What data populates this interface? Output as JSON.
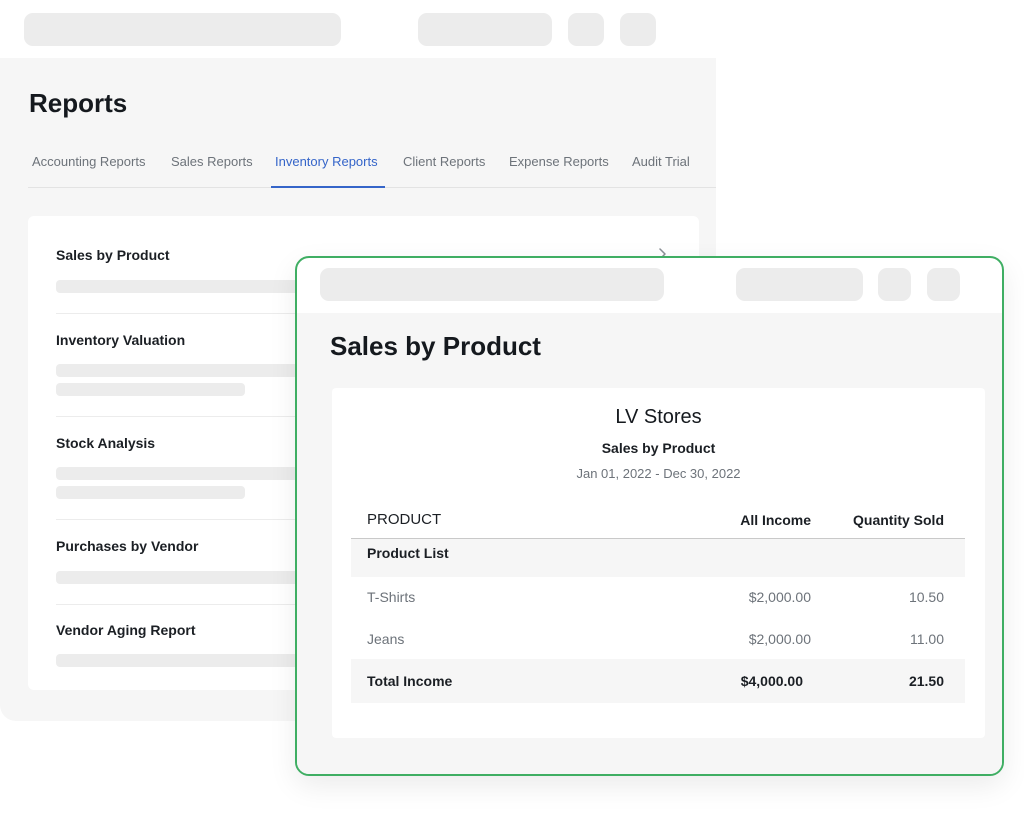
{
  "reports": {
    "title": "Reports",
    "tabs": [
      {
        "label": "Accounting Reports"
      },
      {
        "label": "Sales Reports"
      },
      {
        "label": "Inventory Reports",
        "active": true
      },
      {
        "label": "Client Reports"
      },
      {
        "label": "Expense Reports"
      },
      {
        "label": "Audit Trial"
      }
    ],
    "items": [
      {
        "label": "Sales by Product"
      },
      {
        "label": "Inventory Valuation"
      },
      {
        "label": "Stock Analysis"
      },
      {
        "label": "Purchases by Vendor"
      },
      {
        "label": "Vendor Aging Report"
      }
    ]
  },
  "sales_report": {
    "window_title": "Sales by Product",
    "company": "LV Stores",
    "report_name": "Sales by Product",
    "period": "Jan 01, 2022 - Dec 30, 2022",
    "columns": {
      "product": "PRODUCT",
      "income": "All Income",
      "quantity": "Quantity Sold"
    },
    "group_label": "Product List",
    "rows": [
      {
        "product": "T-Shirts",
        "income": "$2,000.00",
        "quantity": "10.50"
      },
      {
        "product": "Jeans",
        "income": "$2,000.00",
        "quantity": "11.00"
      }
    ],
    "total": {
      "label": "Total Income",
      "income": "$4,000.00",
      "quantity": "21.50"
    }
  },
  "colors": {
    "accent": "#3565c9",
    "highlight_border": "#3fae63",
    "placeholder": "#ececec",
    "panel": "#f6f6f6"
  },
  "icons": {
    "report_item_arrow": "chevron-right-icon"
  }
}
